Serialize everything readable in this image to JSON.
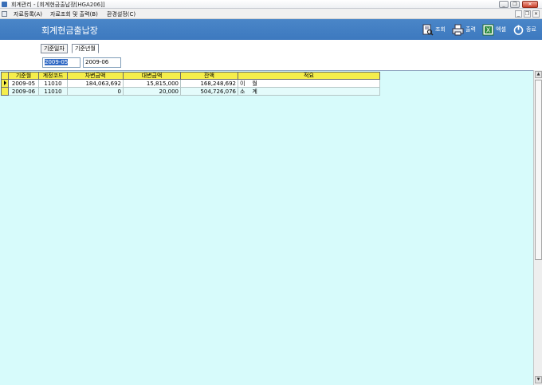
{
  "window": {
    "title": "회계관리 - [회계현금출납장[HGA206]]",
    "minimize": "_",
    "restore": "❐",
    "close": "✕"
  },
  "menu": {
    "items": [
      "자료등록(A)",
      "자료조회 및 출력(B)",
      "환경설정(C)"
    ],
    "mdi_minimize": "_",
    "mdi_restore": "❐",
    "mdi_close": "✕"
  },
  "header": {
    "title": "회계현금출납장",
    "toolbar": [
      {
        "label": "조회",
        "icon": "search-doc-icon"
      },
      {
        "label": "출력",
        "icon": "printer-icon"
      },
      {
        "label": "엑셀",
        "icon": "excel-icon"
      },
      {
        "label": "종료",
        "icon": "power-icon"
      }
    ]
  },
  "filter": {
    "tabs": [
      "기준일자",
      "기준년월"
    ],
    "active_tab": "기준년월",
    "from_value": "2009-05",
    "to_value": "2009-06"
  },
  "grid": {
    "columns": [
      "기준월",
      "계정코드",
      "차변금액",
      "대변금액",
      "잔액",
      "적요"
    ],
    "rows": [
      {
        "month": "2009-05",
        "code": "11010",
        "debit": "184,063,692",
        "credit": "15,815,000",
        "balance": "168,248,692",
        "memo": "이    월"
      },
      {
        "month": "2009-06",
        "code": "11010",
        "debit": "0",
        "credit": "20,000",
        "balance": "504,726,076",
        "memo": "소    계"
      }
    ]
  },
  "colors": {
    "header_bg": "#4a86c8",
    "grid_bg": "#d7fbfb",
    "column_header": "#f5ee4b",
    "selection": "#316ac5"
  }
}
